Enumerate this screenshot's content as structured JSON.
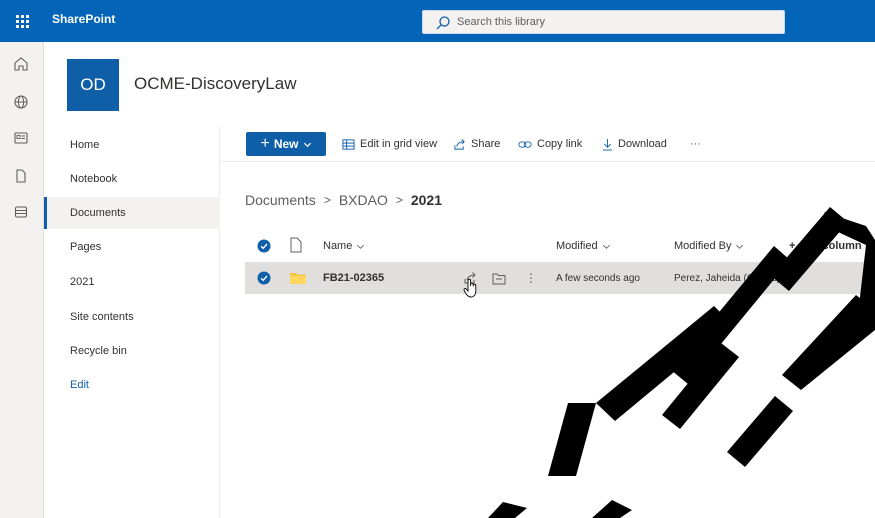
{
  "suite": {
    "brand": "SharePoint",
    "search_placeholder": "Search this library"
  },
  "site": {
    "logo_initials": "OD",
    "title": "OCME-DiscoveryLaw"
  },
  "nav": {
    "items": [
      {
        "label": "Home"
      },
      {
        "label": "Notebook"
      },
      {
        "label": "Documents"
      },
      {
        "label": "Pages"
      },
      {
        "label": "2021"
      },
      {
        "label": "Site contents"
      },
      {
        "label": "Recycle bin"
      }
    ],
    "edit": "Edit"
  },
  "commands": {
    "new": "New",
    "edit_grid": "Edit in grid view",
    "share": "Share",
    "copy_link": "Copy link",
    "download": "Download",
    "more": "···"
  },
  "breadcrumb": {
    "items": [
      "Documents",
      "BXDAO"
    ],
    "current": "2021"
  },
  "list": {
    "columns": {
      "name": "Name",
      "modified": "Modified",
      "modified_by": "Modified By",
      "add_column": "+ Add column"
    },
    "rows": [
      {
        "name": "FB21-02365",
        "modified": "A few seconds ago",
        "modified_by": "Perez, Jaheida (OCME)"
      }
    ]
  },
  "watermark": {
    "text": "VED",
    "color": "#000000"
  },
  "colors": {
    "suite": "#0364b8",
    "primary": "#0f5ea8",
    "folder": "#f5c440"
  }
}
